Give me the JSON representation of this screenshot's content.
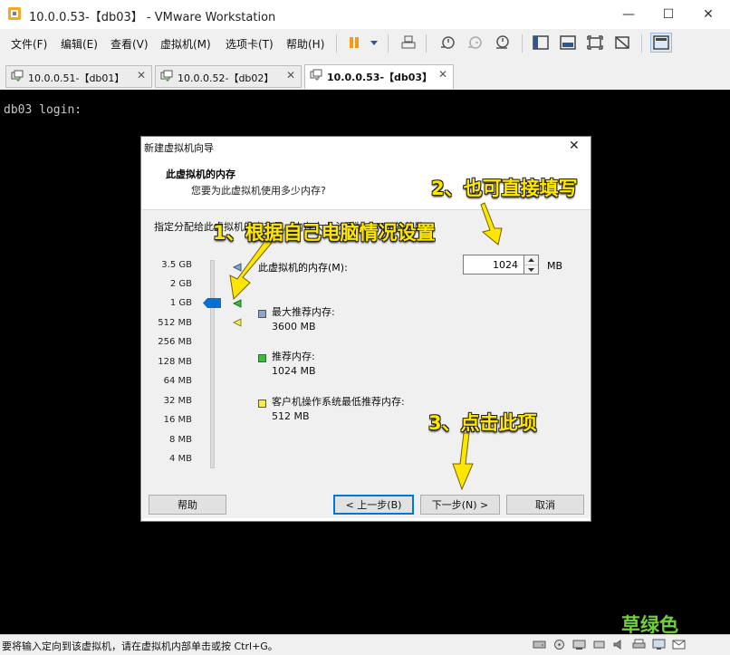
{
  "window": {
    "title": "10.0.0.53-【db03】 - VMware Workstation",
    "controls": {
      "minimize": "—",
      "maximize": "☐",
      "close": "✕"
    }
  },
  "menu": [
    "文件(F)",
    "编辑(E)",
    "查看(V)",
    "虚拟机(M)",
    "选项卡(T)",
    "帮助(H)"
  ],
  "toolbar_icons": [
    "pause-icon",
    "dropdown-icon",
    "send-keys-icon",
    "snapshot-icon",
    "revert-snapshot-icon",
    "manage-snapshots-icon",
    "sidebar-view-icon",
    "console-view-icon",
    "fullscreen-icon",
    "unity-icon",
    "thumbnail-view-icon"
  ],
  "tabs": [
    {
      "label": "10.0.0.51-【db01】",
      "active": false
    },
    {
      "label": "10.0.0.52-【db02】",
      "active": false
    },
    {
      "label": "10.0.0.53-【db03】",
      "active": true
    }
  ],
  "console": {
    "text": "db03 login:"
  },
  "dialog": {
    "title": "新建虚拟机向导",
    "heading": "此虚拟机的内存",
    "subheading": "您要为此虚拟机使用多少内存?",
    "instruction": "指定分配给此虚拟机的内存量。内存大小必须为 4 MB 的倍数。",
    "scale": [
      "3.5 GB",
      "2 GB",
      "1 GB",
      "512 MB",
      "256 MB",
      "128 MB",
      "64 MB",
      "32 MB",
      "16 MB",
      "8 MB",
      "4 MB"
    ],
    "memory_label": "此虚拟机的内存(M):",
    "memory_value": "1024",
    "memory_unit": "MB",
    "legend": [
      {
        "title": "最大推荐内存:",
        "value": "3600 MB",
        "color": "#8aa6c8"
      },
      {
        "title": "推荐内存:",
        "value": "1024 MB",
        "color": "#3dbb3d"
      },
      {
        "title": "客户机操作系统最低推荐内存:",
        "value": "512 MB",
        "color": "#f2ea5a"
      }
    ],
    "buttons": {
      "help": "帮助",
      "back": "< 上一步(B)",
      "next": "下一步(N) >",
      "cancel": "取消"
    }
  },
  "annotations": {
    "step1": "1、根据自己电脑情况设置",
    "step2": "2、也可直接填写",
    "step3": "3、点击此项"
  },
  "status": {
    "text": "要将输入定向到该虚拟机，请在虚拟机内部单击或按 Ctrl+G。"
  },
  "status_icons": [
    "hdd-icon",
    "cdrom-icon",
    "network-icon",
    "usb-icon",
    "sound-icon",
    "printer-icon",
    "display-icon",
    "message-icon"
  ],
  "watermark": "草绿色",
  "colors": {
    "accent": "#0078d7",
    "annotation": "#ffe600",
    "watermark": "#6fd23a"
  }
}
